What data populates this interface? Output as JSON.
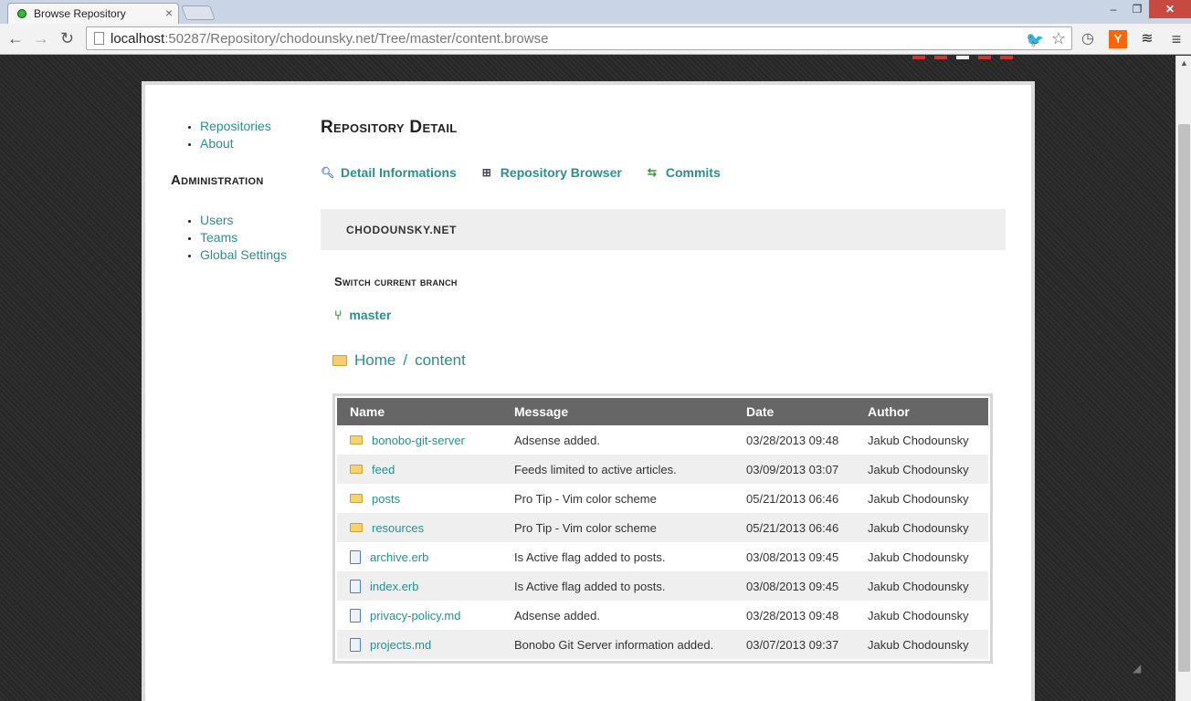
{
  "browser": {
    "tab_title": "Browse Repository",
    "tab_close": "×",
    "url_host": "localhost",
    "url_rest": ":50287/Repository/chodounsky.net/Tree/master/content.browse",
    "win_min": "–",
    "win_max": "❐",
    "win_close": "✕"
  },
  "sidebar": {
    "items": [
      {
        "label": "Repositories"
      },
      {
        "label": "About"
      }
    ],
    "admin_heading": "Administration",
    "admin_items": [
      {
        "label": "Users"
      },
      {
        "label": "Teams"
      },
      {
        "label": "Global Settings"
      }
    ]
  },
  "main": {
    "title": "Repository Detail",
    "actions": [
      {
        "label": "Detail Informations",
        "icon": "magnifier-icon"
      },
      {
        "label": "Repository Browser",
        "icon": "binoculars-icon"
      },
      {
        "label": "Commits",
        "icon": "arrows-icon"
      }
    ],
    "repo_name": "CHODOUNSKY.NET",
    "switch_label": "Switch current branch",
    "branch": "master",
    "breadcrumb": {
      "home": "Home",
      "separator": "/",
      "current": "content"
    }
  },
  "tree": {
    "columns": [
      "Name",
      "Message",
      "Date",
      "Author"
    ],
    "rows": [
      {
        "type": "folder",
        "name": "bonobo-git-server",
        "message": "Adsense added.",
        "date": "03/28/2013 09:48",
        "author": "Jakub Chodounsky"
      },
      {
        "type": "folder",
        "name": "feed",
        "message": "Feeds limited to active articles.",
        "date": "03/09/2013 03:07",
        "author": "Jakub Chodounsky"
      },
      {
        "type": "folder",
        "name": "posts",
        "message": "Pro Tip - Vim color scheme",
        "date": "05/21/2013 06:46",
        "author": "Jakub Chodounsky"
      },
      {
        "type": "folder",
        "name": "resources",
        "message": "Pro Tip - Vim color scheme",
        "date": "05/21/2013 06:46",
        "author": "Jakub Chodounsky"
      },
      {
        "type": "file",
        "name": "archive.erb",
        "message": "Is Active flag added to posts.",
        "date": "03/08/2013 09:45",
        "author": "Jakub Chodounsky"
      },
      {
        "type": "file",
        "name": "index.erb",
        "message": "Is Active flag added to posts.",
        "date": "03/08/2013 09:45",
        "author": "Jakub Chodounsky"
      },
      {
        "type": "file",
        "name": "privacy-policy.md",
        "message": "Adsense added.",
        "date": "03/28/2013 09:48",
        "author": "Jakub Chodounsky"
      },
      {
        "type": "file",
        "name": "projects.md",
        "message": "Bonobo Git Server information added.",
        "date": "03/07/2013 09:37",
        "author": "Jakub Chodounsky"
      }
    ]
  },
  "colors": {
    "link": "#2a8f8f",
    "table_header": "#666666",
    "row_alt": "#efefef",
    "banner": "#eeeeee"
  }
}
